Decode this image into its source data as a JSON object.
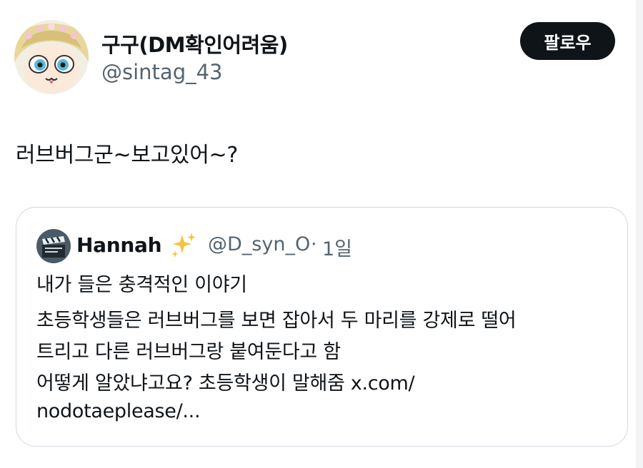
{
  "author": {
    "display_name": "구구(DM확인어려움)",
    "handle": "@sintag_43",
    "avatar_icon": "anime-girl-avatar-icon"
  },
  "follow_button": {
    "label": "팔로우"
  },
  "tweet": {
    "text": "러브버그군~보고있어~?"
  },
  "quoted_tweet": {
    "display_name": "Hannah",
    "emoji_icon": "sparkles-icon",
    "handle": "@D_syn_O",
    "separator": "·",
    "time": "1일",
    "lines": [
      "내가 들은 충격적인 이야기",
      "초등학생들은 러브버그를 보면 잡아서 두 마리를 강제로 떨어",
      "트리고 다른 러브버그랑 붙여둔다고 함",
      "어떻게 알았냐고요? 초등학생이 말해줌 x.com/",
      "nodotaeplease/..."
    ]
  },
  "colors": {
    "text_primary": "#0f1419",
    "text_secondary": "#536471",
    "border": "#cfd9de",
    "button_bg": "#0f1419",
    "button_text": "#ffffff"
  }
}
